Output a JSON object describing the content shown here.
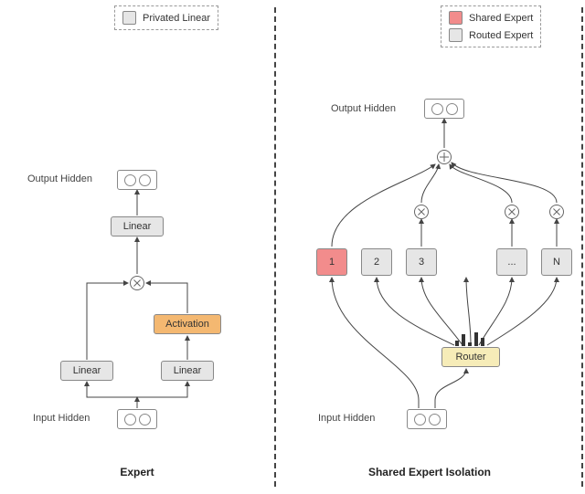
{
  "legend_left": {
    "item1": "Privated Linear"
  },
  "legend_right": {
    "item1": "Shared Expert",
    "item2": "Routed Expert"
  },
  "left": {
    "title": "Expert",
    "output_label": "Output Hidden",
    "input_label": "Input Hidden",
    "linear_top": "Linear",
    "linear_left": "Linear",
    "linear_right": "Linear",
    "activation": "Activation"
  },
  "right": {
    "title": "Shared Expert Isolation",
    "output_label": "Output Hidden",
    "input_label": "Input Hidden",
    "router": "Router",
    "experts": [
      "1",
      "2",
      "3",
      "...",
      "N"
    ]
  },
  "colors": {
    "linear_gray": "#e6e6e6",
    "activation_orange": "#f4b871",
    "shared_red": "#f28c8c",
    "router_yellow": "#f6ecb8"
  },
  "chart_data": {
    "type": "diagram",
    "panels": [
      {
        "name": "Expert",
        "input": "Input Hidden",
        "output": "Output Hidden",
        "blocks": [
          "Linear(gate)",
          "Linear(up)",
          "Activation",
          "Multiply",
          "Linear(down)"
        ],
        "flow": "Input -> Linear(gate); Input -> Linear(up) -> Activation; gate ⊗ activation -> Linear(down) -> Output"
      },
      {
        "name": "Shared Expert Isolation",
        "input": "Input Hidden",
        "output": "Output Hidden",
        "router": true,
        "experts": {
          "shared": [
            "1"
          ],
          "routed": [
            "2",
            "3",
            "...",
            "N"
          ]
        },
        "flow": "Input -> Router -> routed experts (⊗ gates) ; Input -> shared expert 1 ; all -> ⊕ -> Output"
      }
    ]
  }
}
